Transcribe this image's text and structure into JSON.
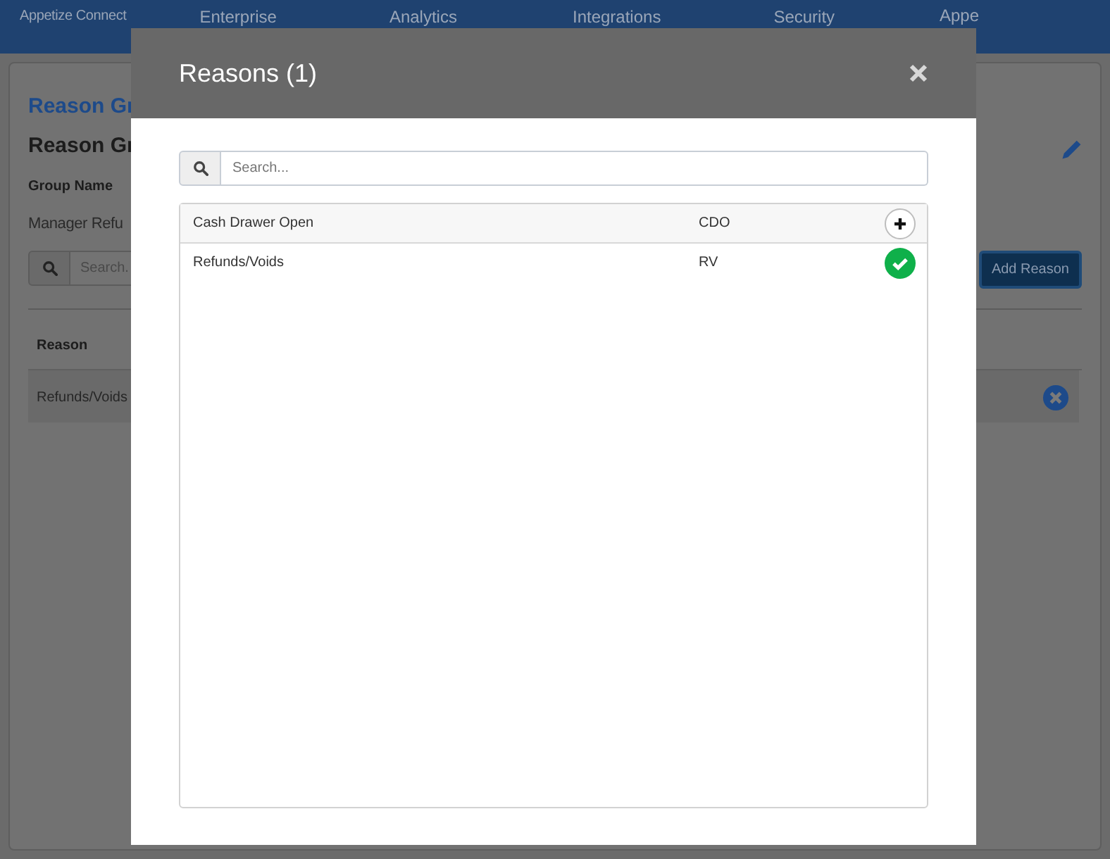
{
  "nav": {
    "brand": "Appetize Connect",
    "items": [
      "Enterprise",
      "Analytics",
      "Integrations",
      "Security"
    ],
    "user": "Appe"
  },
  "page": {
    "breadcrumb": "Reason Gr",
    "title": "Reason Gr",
    "group_name_label": "Group Name",
    "group_name": "Manager Refu",
    "search": {
      "placeholder": "Search."
    },
    "add_button": "Add Reason",
    "table": {
      "columns": [
        "Reason"
      ],
      "rows": [
        {
          "reason": "Refunds/Voids"
        }
      ]
    }
  },
  "modal": {
    "title": "Reasons (1)",
    "search": {
      "placeholder": "Search..."
    },
    "rows": [
      {
        "name": "Cash Drawer Open",
        "code": "CDO",
        "added": false
      },
      {
        "name": "Refunds/Voids",
        "code": "RV",
        "added": true
      }
    ]
  }
}
